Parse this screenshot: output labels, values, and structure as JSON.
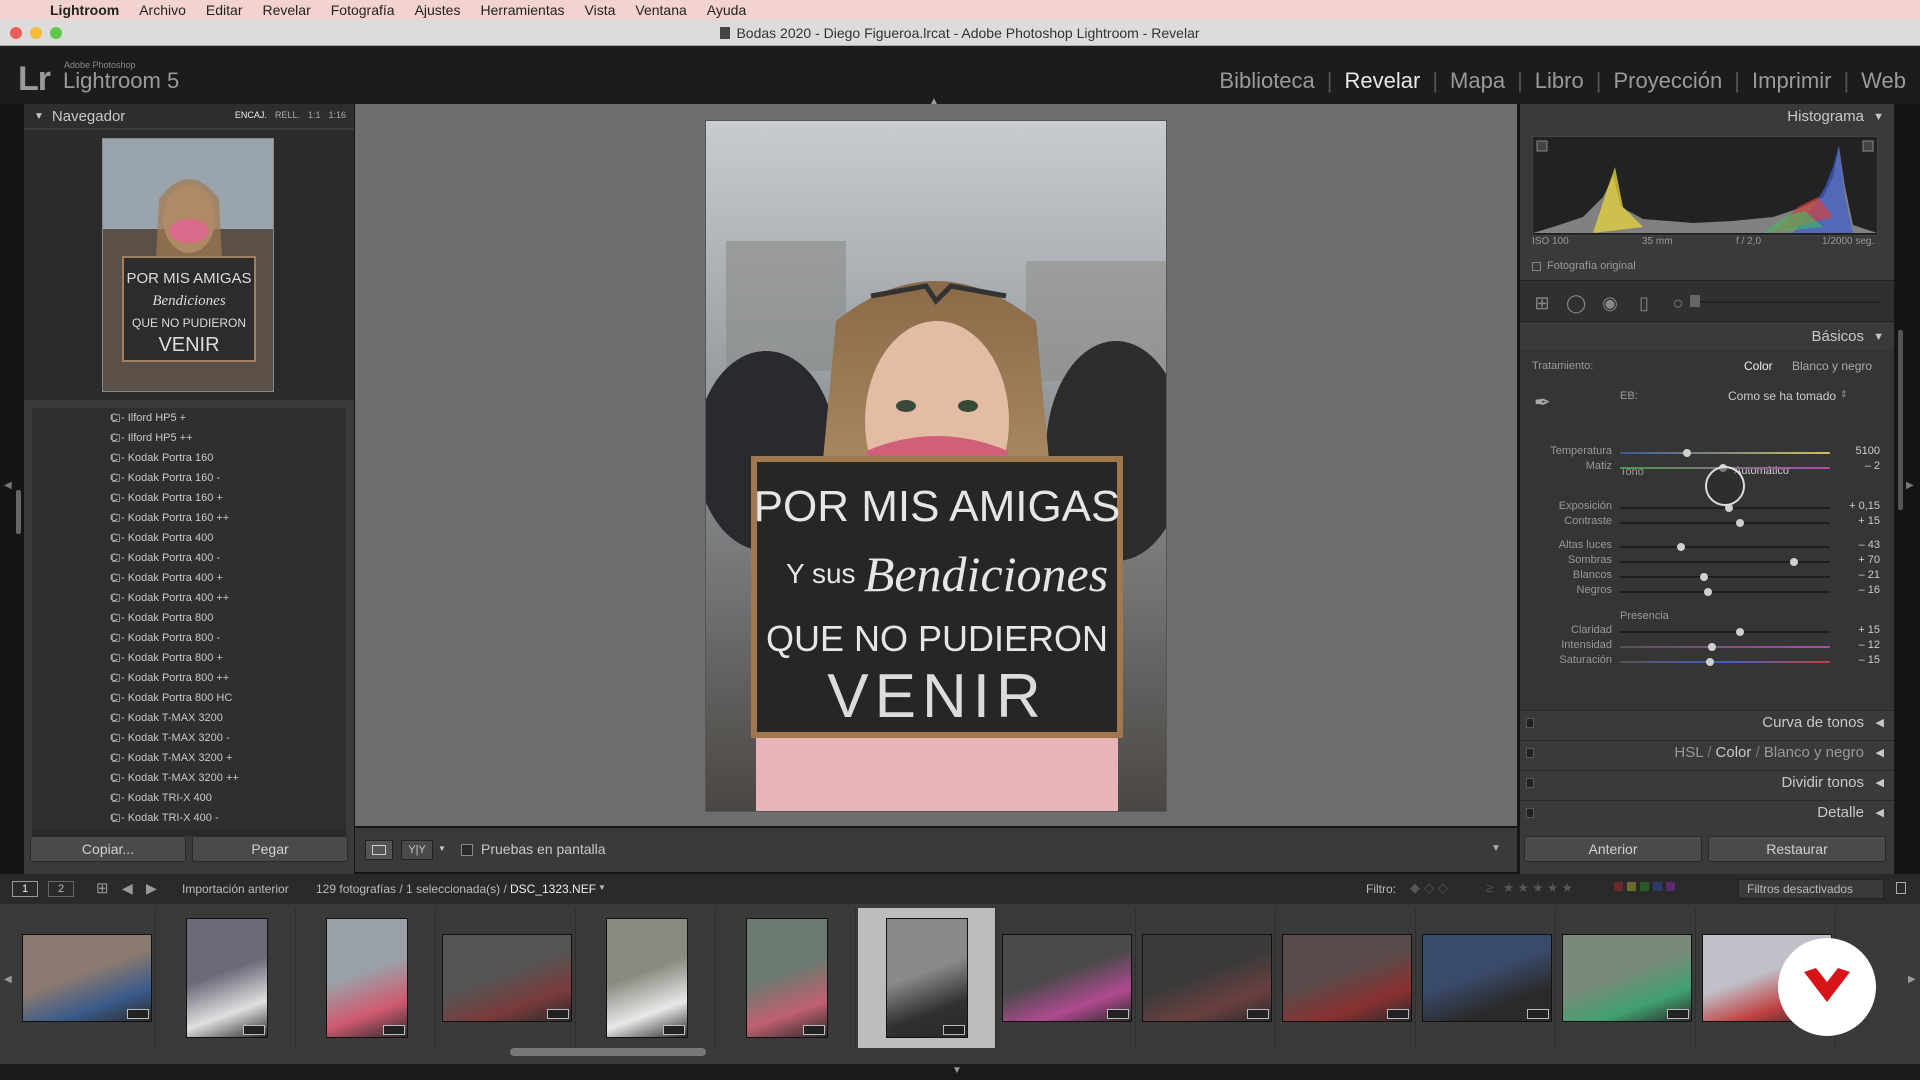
{
  "menubar": {
    "app": "Lightroom",
    "items": [
      "Archivo",
      "Editar",
      "Revelar",
      "Fotografía",
      "Ajustes",
      "Herramientas",
      "Vista",
      "Ventana",
      "Ayuda"
    ]
  },
  "window": {
    "title": "Bodas 2020 - Diego Figueroa.lrcat - Adobe Photoshop Lightroom - Revelar"
  },
  "identity": {
    "logo": "Lr",
    "small": "Adobe Photoshop",
    "big": "Lightroom 5"
  },
  "modules": [
    "Biblioteca",
    "Revelar",
    "Mapa",
    "Libro",
    "Proyección",
    "Imprimir",
    "Web"
  ],
  "active_module": "Revelar",
  "navigator": {
    "title": "Navegador",
    "zoom": [
      "ENCAJ.",
      "RELL.",
      "1:1",
      "1:16"
    ]
  },
  "presets": [
    "C - Ilford HP5 +",
    "C - Ilford HP5 ++",
    "C - Kodak Portra 160",
    "C - Kodak Portra 160 -",
    "C - Kodak Portra 160 +",
    "C - Kodak Portra 160 ++",
    "C - Kodak Portra 400",
    "C - Kodak Portra 400 -",
    "C - Kodak Portra 400 +",
    "C - Kodak Portra 400 ++",
    "C - Kodak Portra 800",
    "C - Kodak Portra 800 -",
    "C - Kodak Portra 800 +",
    "C - Kodak Portra 800 ++",
    "C - Kodak Portra 800 HC",
    "C - Kodak T-MAX 3200",
    "C - Kodak T-MAX 3200 -",
    "C - Kodak T-MAX 3200 +",
    "C - Kodak T-MAX 3200 ++",
    "C - Kodak TRI-X 400",
    "C - Kodak TRI-X 400 -"
  ],
  "left_buttons": {
    "copy": "Copiar...",
    "paste": "Pegar"
  },
  "photo_sign": {
    "l1": "POR MIS AMIGAS",
    "l2a": "Y sus",
    "l2b": "Bendiciones",
    "l3": "QUE NO PUDIERON",
    "l4": "VENIR"
  },
  "toolbar": {
    "view_yy": "Y|Y",
    "proofing": "Pruebas en pantalla"
  },
  "histogram": {
    "title": "Histograma",
    "iso": "ISO 100",
    "focal": "35 mm",
    "aperture": "f / 2,0",
    "shutter": "1/2000 seg.",
    "original": "Fotografía original"
  },
  "basics": {
    "title": "Básicos",
    "treatment_label": "Tratamiento:",
    "treatment_color": "Color",
    "treatment_bw": "Blanco y negro",
    "wb_label": "EB:",
    "wb_value": "Como se ha tomado",
    "tone_label": "Tono",
    "auto": "Automático",
    "presence_label": "Presencia",
    "sliders": [
      {
        "label": "Temperatura",
        "value": "5100",
        "pos": 0.32
      },
      {
        "label": "Matiz",
        "value": "– 2",
        "pos": 0.49
      },
      {
        "label": "Exposición",
        "value": "+ 0,15",
        "pos": 0.52
      },
      {
        "label": "Contraste",
        "value": "+ 15",
        "pos": 0.57
      },
      {
        "label": "Altas luces",
        "value": "– 43",
        "pos": 0.29
      },
      {
        "label": "Sombras",
        "value": "+ 70",
        "pos": 0.83
      },
      {
        "label": "Blancos",
        "value": "– 21",
        "pos": 0.4
      },
      {
        "label": "Negros",
        "value": "– 16",
        "pos": 0.42
      },
      {
        "label": "Claridad",
        "value": "+ 15",
        "pos": 0.57
      },
      {
        "label": "Intensidad",
        "value": "– 12",
        "pos": 0.44
      },
      {
        "label": "Saturación",
        "value": "– 15",
        "pos": 0.43
      }
    ]
  },
  "collapsed_panels": {
    "tone_curve": "Curva de tonos",
    "hsl": "HSL",
    "hsl_color": "Color",
    "hsl_bw": "Blanco y negro",
    "split": "Dividir tonos",
    "detail": "Detalle"
  },
  "right_buttons": {
    "prev": "Anterior",
    "reset": "Restaurar"
  },
  "filmbar": {
    "screen1": "1",
    "screen2": "2",
    "source": "Importación anterior",
    "count": "129 fotografías / 1 seleccionada(s) /",
    "file": "DSC_1323.NEF",
    "filter": "Filtro:",
    "filters_off": "Filtros desactivados"
  },
  "film_thumbs": [
    {
      "w": 130,
      "h": 88,
      "c1": "#8a7a70",
      "c2": "#3a5a8a"
    },
    {
      "w": 82,
      "h": 120,
      "c1": "#6a6a7a",
      "c2": "#e0e0e0"
    },
    {
      "w": 82,
      "h": 120,
      "c1": "#9aa0a8",
      "c2": "#d05a70"
    },
    {
      "w": 130,
      "h": 88,
      "c1": "#555",
      "c2": "#7a3a3a"
    },
    {
      "w": 82,
      "h": 120,
      "c1": "#8a8a80",
      "c2": "#e8e8e8"
    },
    {
      "w": 82,
      "h": 120,
      "c1": "#6a7a70",
      "c2": "#c06070"
    },
    {
      "w": 82,
      "h": 120,
      "c1": "#8a8a8a",
      "c2": "#303030"
    },
    {
      "w": 130,
      "h": 88,
      "c1": "#4a4a4a",
      "c2": "#b04a90"
    },
    {
      "w": 130,
      "h": 88,
      "c1": "#3a3a3a",
      "c2": "#6a4040"
    },
    {
      "w": 130,
      "h": 88,
      "c1": "#5a4a4a",
      "c2": "#8a3030"
    },
    {
      "w": 130,
      "h": 88,
      "c1": "#3a4a6a",
      "c2": "#2a2a2a"
    },
    {
      "w": 130,
      "h": 88,
      "c1": "#7a8a7a",
      "c2": "#40a070"
    },
    {
      "w": 130,
      "h": 88,
      "c1": "#c0c0c8",
      "c2": "#c04040"
    }
  ]
}
